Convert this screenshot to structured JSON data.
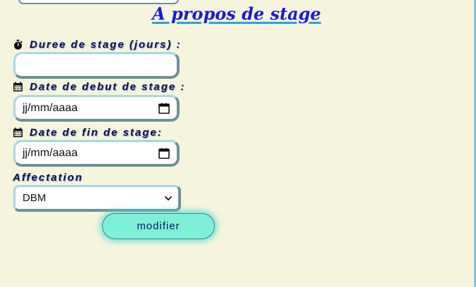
{
  "section": {
    "title": "A propos de stage"
  },
  "form": {
    "duration": {
      "label": "Duree de stage (jours) :",
      "icon": "stopwatch-icon",
      "value": ""
    },
    "start_date": {
      "label": "Date de debut de stage :",
      "icon": "calendar-icon",
      "placeholder": "jj/mm/aaaa"
    },
    "end_date": {
      "label": "Date de fin de stage:",
      "icon": "calendar-icon",
      "placeholder": "jj/mm/aaaa"
    },
    "affectation": {
      "label": "Affectation",
      "selected": "DBM"
    },
    "submit_label": "modifier"
  },
  "colors": {
    "background": "#f5f4dc",
    "title": "#1a1adb",
    "title_underline": "#27a7d8",
    "label": "#0a0f5a",
    "button": "#7ef0d8"
  }
}
